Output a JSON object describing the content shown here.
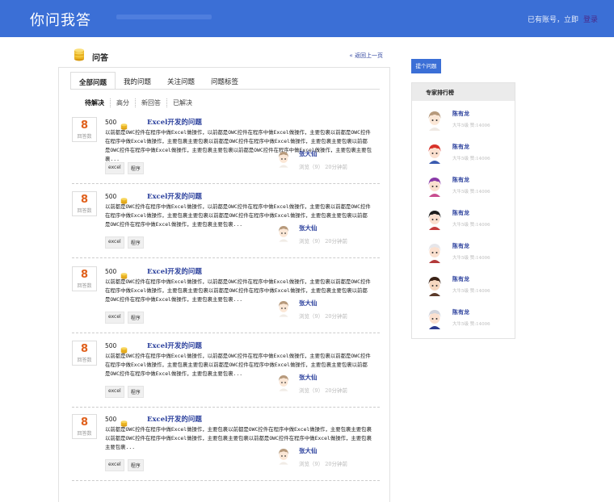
{
  "header": {
    "brand": "你问我答",
    "login_prompt": "已有账号，立即",
    "login_link": "登录",
    "bar_color": "#3b6fd6"
  },
  "section": {
    "title": "问答",
    "back_link": "« 返回上一页",
    "icon": "coin-stack-icon"
  },
  "tabs": [
    {
      "label": "全部问题",
      "active": true
    },
    {
      "label": "我的问题",
      "active": false
    },
    {
      "label": "关注问题",
      "active": false
    },
    {
      "label": "问题标签",
      "active": false
    }
  ],
  "filters": [
    "待解决",
    "高分",
    "新回答",
    "已解决"
  ],
  "questions": [
    {
      "answers": "8",
      "answers_label": "回答数",
      "reward": "500",
      "title": "Excel开发的问题",
      "desc": "以前都是OWC控件在程序中做Excel做操作，以前都是OWC控件在程序中做Excel做操作，主要包裹以前都是OWC控件在程序中做Excel做操作，主要包裹主要包裹以前都是OWC控件在程序中做Excel做操作，主要包裹主要包裹以前都是OWC控件在程序中做Excel做操作，主要包裹主要包裹以前都是OWC控件在程序中做Excel做操作，主要包裹主要包裹...",
      "tags": [
        "excel",
        "程序"
      ],
      "asker": "张大仙",
      "meta": "浏览（9） 20分钟前"
    },
    {
      "answers": "8",
      "answers_label": "回答数",
      "reward": "500",
      "title": "Excel开发的问题",
      "desc": "以前都是OWC控件在程序中做Excel做操作，以前都是OWC控件在程序中做Excel做操作，主要包裹以前都是OWC控件在程序中做Excel做操作，主要包裹主要包裹以前都是OWC控件在程序中做Excel做操作，主要包裹主要包裹以前都是OWC控件在程序中做Excel做操作，主要包裹主要包裹...",
      "tags": [
        "excel",
        "程序"
      ],
      "asker": "张大仙",
      "meta": "浏览（9） 20分钟前"
    },
    {
      "answers": "8",
      "answers_label": "回答数",
      "reward": "500",
      "title": "Excel开发的问题",
      "desc": "以前都是OWC控件在程序中做Excel做操作，以前都是OWC控件在程序中做Excel做操作，主要包裹以前都是OWC控件在程序中做Excel做操作，主要包裹主要包裹以前都是OWC控件在程序中做Excel做操作，主要包裹主要包裹以前都是OWC控件在程序中做Excel做操作，主要包裹主要包裹...",
      "tags": [
        "excel",
        "程序"
      ],
      "asker": "张大仙",
      "meta": "浏览（9） 20分钟前"
    },
    {
      "answers": "8",
      "answers_label": "回答数",
      "reward": "500",
      "title": "Excel开发的问题",
      "desc": "以前都是OWC控件在程序中做Excel做操作，以前都是OWC控件在程序中做Excel做操作，主要包裹以前都是OWC控件在程序中做Excel做操作，主要包裹主要包裹以前都是OWC控件在程序中做Excel做操作，主要包裹主要包裹以前都是OWC控件在程序中做Excel做操作，主要包裹主要包裹...",
      "tags": [
        "excel",
        "程序"
      ],
      "asker": "张大仙",
      "meta": "浏览（9） 20分钟前"
    },
    {
      "answers": "8",
      "answers_label": "回答数",
      "reward": "500",
      "title": "Excel开发的问题",
      "desc": "以前都是OWC控件在程序中做Excel做操作，主要包裹以前都是OWC控件在程序中做Excel做操作，主要包裹主要包裹以前都是OWC控件在程序中做Excel做操作，主要包裹主要包裹以前都是OWC控件在程序中做Excel做操作，主要包裹主要包裹...",
      "tags": [
        "excel",
        "程序"
      ],
      "asker": "张大仙",
      "meta": "浏览（9） 20分钟前"
    }
  ],
  "ask_button": "提个问题",
  "ranking": {
    "title": "专家排行榜",
    "experts": [
      {
        "name": "陈有龙",
        "meta": "大牛5级 赞:14006",
        "avatar": "user-avatar-icon"
      },
      {
        "name": "陈有龙",
        "meta": "大牛5级 赞:14006",
        "avatar": "user-avatar-icon"
      },
      {
        "name": "陈有龙",
        "meta": "大牛5级 赞:14006",
        "avatar": "user-avatar-icon"
      },
      {
        "name": "陈有龙",
        "meta": "大牛5级 赞:14006",
        "avatar": "user-avatar-icon"
      },
      {
        "name": "陈有龙",
        "meta": "大牛5级 赞:14006",
        "avatar": "user-avatar-icon"
      },
      {
        "name": "陈有龙",
        "meta": "大牛5级 赞:14006",
        "avatar": "user-avatar-icon"
      },
      {
        "name": "陈有龙",
        "meta": "大牛5级 赞:14006",
        "avatar": "user-avatar-icon"
      }
    ]
  }
}
